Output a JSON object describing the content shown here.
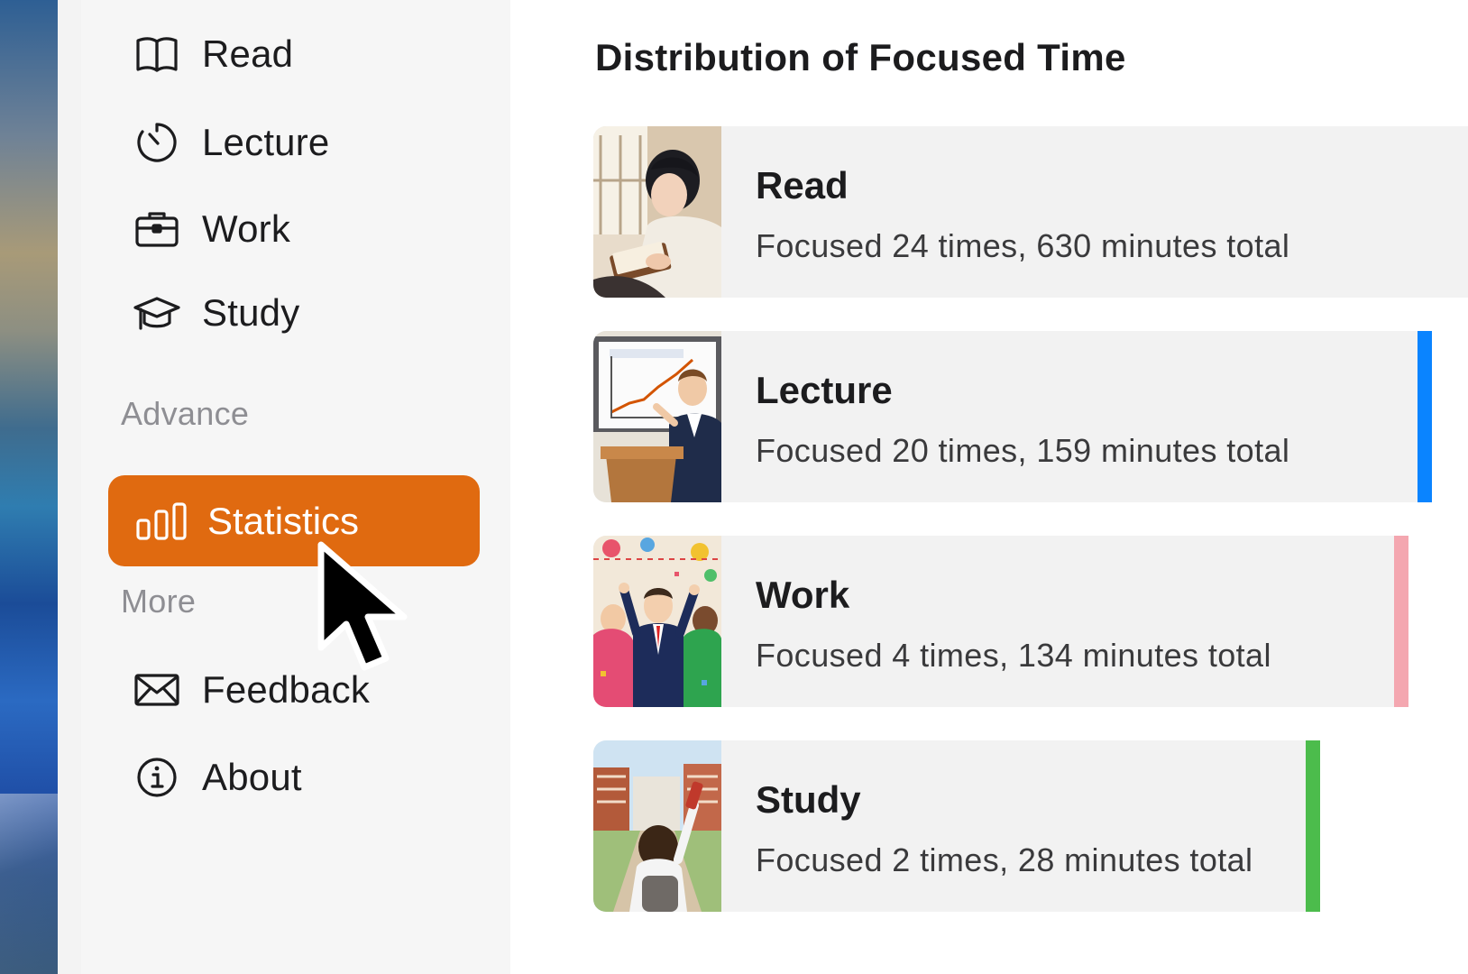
{
  "sidebar": {
    "items_top": [
      {
        "label": "Read",
        "icon": "book-icon"
      },
      {
        "label": "Lecture",
        "icon": "timer-icon"
      },
      {
        "label": "Work",
        "icon": "briefcase-icon"
      },
      {
        "label": "Study",
        "icon": "graduation-cap-icon"
      }
    ],
    "section_advance": "Advance",
    "active_item": {
      "label": "Statistics",
      "icon": "bar-chart-icon"
    },
    "section_more": "More",
    "items_bottom": [
      {
        "label": "Feedback",
        "icon": "envelope-icon"
      },
      {
        "label": "About",
        "icon": "info-icon"
      }
    ]
  },
  "main": {
    "title": "Distribution of Focused Time",
    "cards": [
      {
        "title": "Read",
        "subtitle": "Focused 24 times, 630 minutes total",
        "bar_color": "#f2f2f2"
      },
      {
        "title": "Lecture",
        "subtitle": "Focused 20 times, 159 minutes total",
        "bar_color": "#0a84ff"
      },
      {
        "title": "Work",
        "subtitle": "Focused 4 times, 134 minutes total",
        "bar_color": "#f4a7b0"
      },
      {
        "title": "Study",
        "subtitle": "Focused 2 times, 28 minutes total",
        "bar_color": "#4cbc4c"
      }
    ]
  },
  "colors": {
    "accent": "#e06a10",
    "sidebar_bg": "#f6f6f6",
    "card_bg": "#f2f2f2"
  }
}
